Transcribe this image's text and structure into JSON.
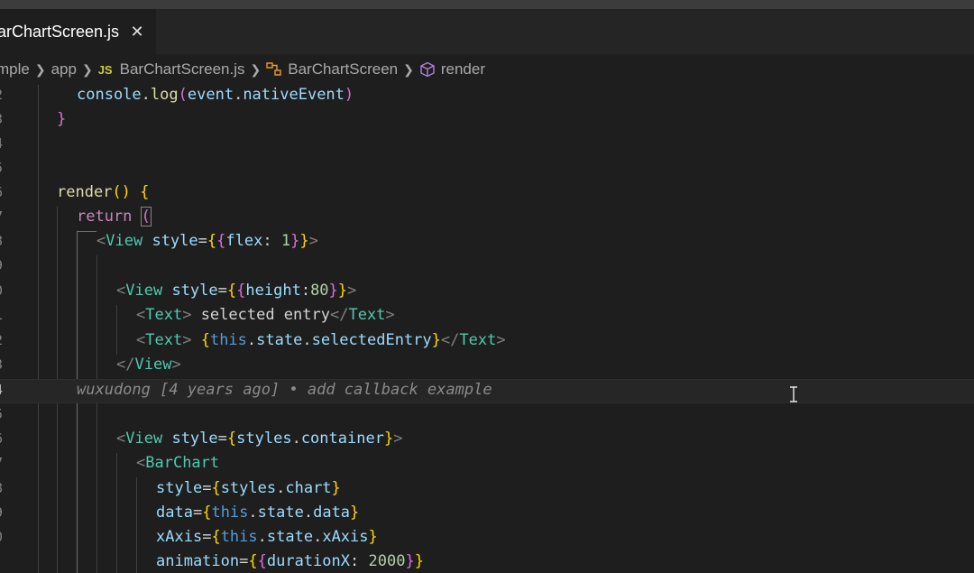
{
  "tab": {
    "label": "arChartScreen.js",
    "close_glyph": "✕"
  },
  "breadcrumb": {
    "items": [
      {
        "label": "mple",
        "icon": ""
      },
      {
        "label": "app",
        "icon": ""
      },
      {
        "label": "BarChartScreen.js",
        "icon": "js-file-icon",
        "badge": "JS"
      },
      {
        "label": "BarChartScreen",
        "icon": "class-icon"
      },
      {
        "label": "render",
        "icon": "method-cube-icon"
      }
    ]
  },
  "gutter": [
    "2",
    "3",
    "4",
    "5",
    "6",
    "7",
    "8",
    "9",
    "0",
    "1",
    "2",
    "3",
    "4",
    "5",
    "6",
    "7",
    "8",
    "9",
    "0"
  ],
  "code": {
    "l1_obj": "console",
    "l1_dot": ".",
    "l1_fn": "log",
    "l1_open": "(",
    "l1_arg1": "event",
    "l1_dot2": ".",
    "l1_arg2": "nativeEvent",
    "l1_close": ")",
    "l2": "}",
    "l5_fn": "render",
    "l5_parens": "()",
    "l5_brace": " {",
    "l6_kw": "return",
    "l6_paren": "(",
    "l7_lt": "<",
    "l7_tag": "View",
    "l7_attr": "style",
    "l7_eq": "=",
    "l7_o1": "{",
    "l7_o2": "{",
    "l7_key": "flex",
    "l7_colon": ": ",
    "l7_num": "1",
    "l7_c2": "}",
    "l7_c1": "}",
    "l7_gt": ">",
    "l9_lt": "<",
    "l9_tag": "View",
    "l9_attr": "style",
    "l9_eq": "=",
    "l9_o1": "{",
    "l9_o2": "{",
    "l9_key": "height",
    "l9_colon": ":",
    "l9_num": "80",
    "l9_c2": "}",
    "l9_c1": "}",
    "l9_gt": ">",
    "l10_lt": "<",
    "l10_tag": "Text",
    "l10_gt": ">",
    "l10_text": " selected entry",
    "l10_lt2": "</",
    "l10_tag2": "Text",
    "l10_gt2": ">",
    "l11_lt": "<",
    "l11_tag": "Text",
    "l11_gt": ">",
    "l11_sp": " ",
    "l11_o": "{",
    "l11_this": "this",
    "l11_d1": ".",
    "l11_state": "state",
    "l11_d2": ".",
    "l11_prop": "selectedEntry",
    "l11_c": "}",
    "l11_lt2": "</",
    "l11_tag2": "Text",
    "l11_gt2": ">",
    "l12_lt": "</",
    "l12_tag": "View",
    "l12_gt": ">",
    "blame": "wuxudong [4 years ago] • add callback example",
    "l15_lt": "<",
    "l15_tag": "View",
    "l15_attr": "style",
    "l15_eq": "=",
    "l15_o": "{",
    "l15_obj": "styles",
    "l15_d": ".",
    "l15_prop": "container",
    "l15_c": "}",
    "l15_gt": ">",
    "l16_lt": "<",
    "l16_tag": "BarChart",
    "l17_attr": "style",
    "l17_eq": "=",
    "l17_o": "{",
    "l17_obj": "styles",
    "l17_d": ".",
    "l17_prop": "chart",
    "l17_c": "}",
    "l18_attr": "data",
    "l18_eq": "=",
    "l18_o": "{",
    "l18_this": "this",
    "l18_d1": ".",
    "l18_state": "state",
    "l18_d2": ".",
    "l18_prop": "data",
    "l18_c": "}",
    "l19_attr": "xAxis",
    "l19_eq": "=",
    "l19_o": "{",
    "l19_this": "this",
    "l19_d1": ".",
    "l19_state": "state",
    "l19_d2": ".",
    "l19_prop": "xAxis",
    "l19_c": "}",
    "l20_attr": "animation",
    "l20_eq": "=",
    "l20_o1": "{",
    "l20_o2": "{",
    "l20_key": "durationX",
    "l20_colon": ": ",
    "l20_num": "2000",
    "l20_c2": "}",
    "l20_c1": "}"
  }
}
